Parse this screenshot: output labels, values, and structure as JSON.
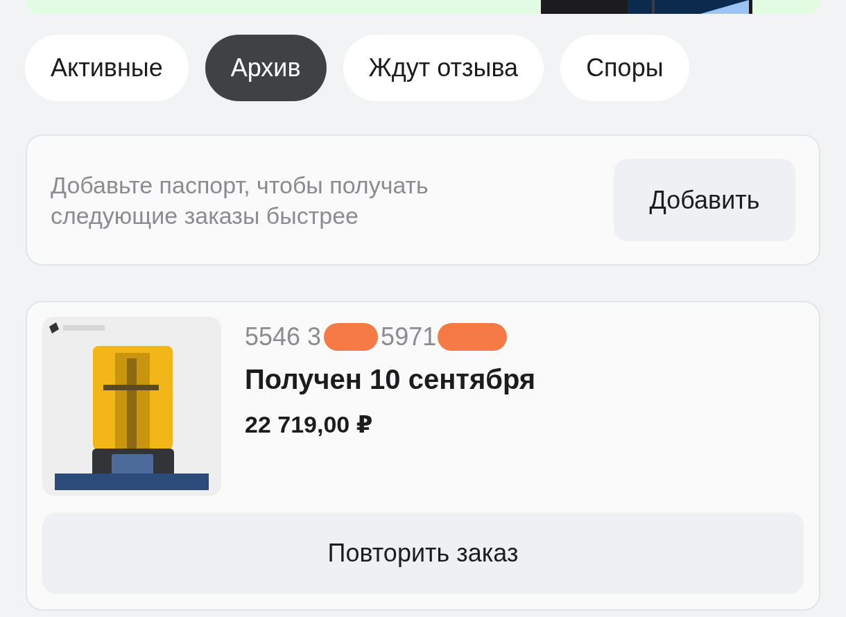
{
  "tabs": [
    {
      "label": "Активные",
      "selected": false
    },
    {
      "label": "Архив",
      "selected": true
    },
    {
      "label": "Ждут отзыва",
      "selected": false
    },
    {
      "label": "Споры",
      "selected": false
    }
  ],
  "notice": {
    "text": "Добавьте паспорт, чтобы получать следующие заказы быстрее",
    "button": "Добавить"
  },
  "order": {
    "number_parts": [
      "5546 3",
      "5971"
    ],
    "status": "Получен 10 сентября",
    "price": "22 719,00 ₽",
    "button": "Повторить заказ"
  }
}
